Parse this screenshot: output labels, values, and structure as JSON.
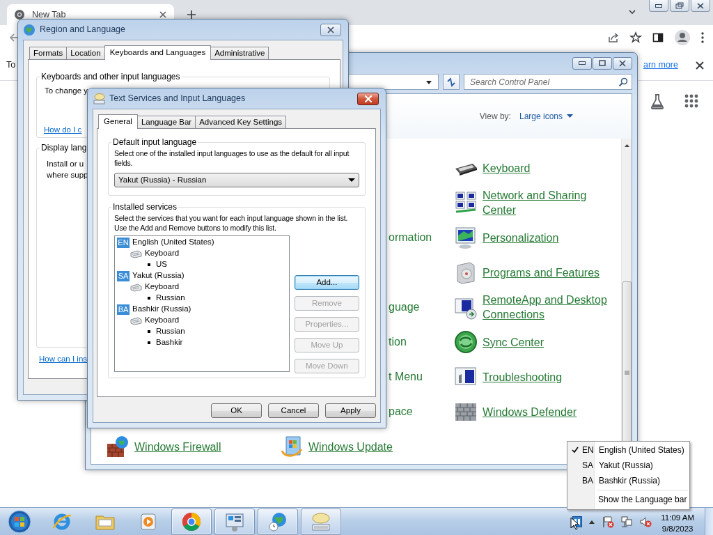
{
  "browser": {
    "tab": {
      "title": "New Tab"
    },
    "infobar": {
      "text": "To",
      "link": "arn more"
    }
  },
  "control_panel": {
    "search": {
      "placeholder": "Search Control Panel"
    },
    "view_by": {
      "label": "View by:",
      "value": "Large icons"
    },
    "rows": [
      {
        "right": {
          "kind": "keyboard",
          "label": "Keyboard"
        }
      },
      {
        "right": {
          "kind": "network",
          "label": "Network and Sharing Center"
        }
      },
      {
        "middle": {
          "label": "ormation",
          "cut": true
        },
        "right": {
          "kind": "personalization",
          "label": "Personalization"
        }
      },
      {
        "right": {
          "kind": "programs",
          "label": "Programs and Features"
        }
      },
      {
        "middle": {
          "label": "guage",
          "cut": true
        },
        "right": {
          "kind": "remote",
          "label": "RemoteApp and Desktop Connections"
        }
      },
      {
        "middle": {
          "label": "tion",
          "cut": true
        },
        "right": {
          "kind": "sync",
          "label": "Sync Center"
        }
      },
      {
        "middle": {
          "label": "t Menu",
          "cut": true
        },
        "right": {
          "kind": "troubleshoot",
          "label": "Troubleshooting"
        }
      },
      {
        "middle": {
          "label": "pace",
          "cut": true
        },
        "right": {
          "kind": "defender",
          "label": "Windows Defender"
        }
      },
      {
        "left": {
          "kind": "firewall",
          "label": "Windows Firewall"
        },
        "middle": {
          "kind": "update",
          "label": "Windows Update"
        }
      }
    ]
  },
  "region_dialog": {
    "title": "Region and Language",
    "tabs": [
      {
        "label": "Formats",
        "selected": false
      },
      {
        "label": "Location",
        "selected": false
      },
      {
        "label": "Keyboards and Languages",
        "selected": true
      },
      {
        "label": "Administrative",
        "selected": false
      }
    ],
    "groups": [
      {
        "title": "Keyboards and other input languages",
        "lines": [
          "To change y"
        ],
        "link": "How do I c"
      },
      {
        "title": "Display lang",
        "lines": [
          "Install or u",
          "where supp"
        ]
      }
    ],
    "link": "How can I ins"
  },
  "text_services": {
    "title": "Text Services and Input Languages",
    "tabs": [
      {
        "label": "General",
        "selected": true
      },
      {
        "label": "Language Bar",
        "selected": false
      },
      {
        "label": "Advanced Key Settings",
        "selected": false
      }
    ],
    "default_language": {
      "title": "Default input language",
      "description": "Select one of the installed input languages to use as the default for all input fields.",
      "value": "Yakut (Russia) - Russian"
    },
    "installed_services": {
      "title": "Installed services",
      "description": "Select the services that you want for each input language shown in the list. Use the Add and Remove buttons to modify this list.",
      "tree": [
        {
          "code": "EN",
          "label": "English (United States)",
          "children": [
            {
              "label": "Keyboard",
              "children": [
                {
                  "label": "US"
                }
              ]
            }
          ]
        },
        {
          "code": "SA",
          "label": "Yakut (Russia)",
          "children": [
            {
              "label": "Keyboard",
              "children": [
                {
                  "label": "Russian"
                }
              ]
            }
          ]
        },
        {
          "code": "BA",
          "label": "Bashkir (Russia)",
          "children": [
            {
              "label": "Keyboard",
              "children": [
                {
                  "label": "Russian"
                },
                {
                  "label": "Bashkir"
                }
              ]
            }
          ]
        }
      ],
      "buttons": [
        {
          "label": "Add...",
          "disabled": false,
          "default": true
        },
        {
          "label": "Remove",
          "disabled": true
        },
        {
          "label": "Properties...",
          "disabled": true
        },
        {
          "label": "Move Up",
          "disabled": true
        },
        {
          "label": "Move Down",
          "disabled": true
        }
      ]
    },
    "footer_buttons": [
      {
        "label": "OK"
      },
      {
        "label": "Cancel"
      },
      {
        "label": "Apply"
      }
    ]
  },
  "language_menu": {
    "items": [
      {
        "code": "EN",
        "label": "English (United States)",
        "checked": true
      },
      {
        "code": "SA",
        "label": "Yakut (Russia)",
        "checked": false
      },
      {
        "code": "BA",
        "label": "Bashkir (Russia)",
        "checked": false
      }
    ],
    "footer": "Show the Language bar"
  },
  "taskbar": {
    "apps": [
      {
        "kind": "ie",
        "running": false
      },
      {
        "kind": "explorer",
        "running": false
      },
      {
        "kind": "media",
        "running": false
      },
      {
        "kind": "chrome",
        "running": true
      },
      {
        "kind": "control_panel",
        "running": true
      },
      {
        "kind": "region",
        "running": true
      },
      {
        "kind": "keyboard",
        "running": true
      }
    ],
    "clock": {
      "time": "11:09 AM",
      "date": "9/8/2023"
    }
  }
}
